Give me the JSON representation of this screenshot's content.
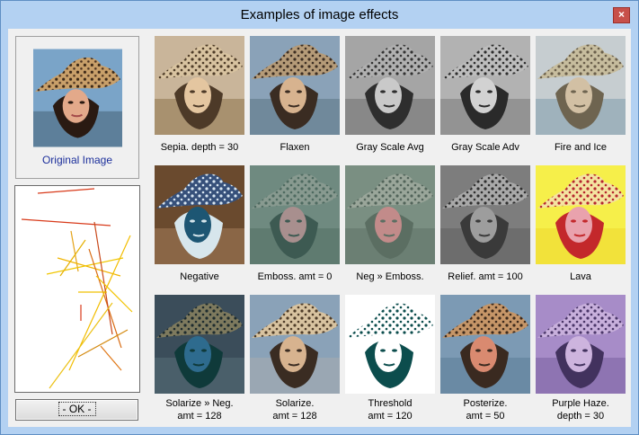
{
  "window": {
    "title": "Examples of image effects",
    "close_glyph": "×"
  },
  "original": {
    "caption": "Original Image"
  },
  "ok_button": {
    "label": "-  OK  -"
  },
  "effects": [
    {
      "id": "sepia",
      "label": "Sepia. depth = 30"
    },
    {
      "id": "flaxen",
      "label": "Flaxen"
    },
    {
      "id": "grayavg",
      "label": "Gray Scale Avg"
    },
    {
      "id": "grayadv",
      "label": "Gray Scale Adv"
    },
    {
      "id": "fireice",
      "label": "Fire and Ice"
    },
    {
      "id": "negative",
      "label": "Negative"
    },
    {
      "id": "emboss",
      "label": "Emboss. amt = 0"
    },
    {
      "id": "negemboss",
      "label": "Neg » Emboss."
    },
    {
      "id": "relief",
      "label": "Relief. amt = 100"
    },
    {
      "id": "lava",
      "label": "Lava"
    },
    {
      "id": "solarneg",
      "label": "Solarize » Neg.",
      "label2": "amt = 128"
    },
    {
      "id": "solar",
      "label": "Solarize.",
      "label2": "amt = 128"
    },
    {
      "id": "threshold",
      "label": "Threshold",
      "label2": "amt = 120"
    },
    {
      "id": "posterize",
      "label": "Posterize.",
      "label2": "amt = 50"
    },
    {
      "id": "purple",
      "label": "Purple Haze.",
      "label2": "depth = 30"
    }
  ],
  "colors": {
    "titlebar": "#b3d1f2",
    "client": "#f0f0f0",
    "close": "#c7504a",
    "caption_link": "#1c2f9b"
  }
}
